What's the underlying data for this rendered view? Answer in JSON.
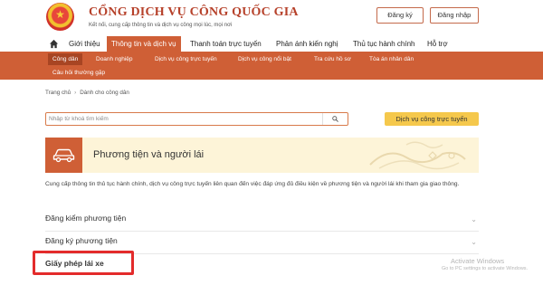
{
  "header": {
    "site_title": "CỔNG DỊCH VỤ CÔNG QUỐC GIA",
    "subtitle": "Kết nối, cung cấp thông tin và dịch vụ công mọi lúc, mọi nơi",
    "register_label": "Đăng ký",
    "login_label": "Đăng nhập"
  },
  "main_nav": {
    "items": [
      {
        "label": "Giới thiệu"
      },
      {
        "label": "Thông tin và dịch vụ"
      },
      {
        "label": "Thanh toán trực tuyến"
      },
      {
        "label": "Phản ánh kiến nghị"
      },
      {
        "label": "Thủ tục hành chính"
      },
      {
        "label": "Hỗ trợ"
      }
    ],
    "active": "Thông tin và dịch vụ"
  },
  "sub_nav": {
    "items": [
      {
        "label": "Công dân"
      },
      {
        "label": "Doanh nghiệp"
      },
      {
        "label": "Dịch vụ công trực tuyến"
      },
      {
        "label": "Dịch vụ công nổi bật"
      },
      {
        "label": "Tra cứu hồ sơ"
      },
      {
        "label": "Tòa án nhân dân"
      },
      {
        "label": "Câu hỏi thường gặp"
      }
    ],
    "active": "Công dân"
  },
  "breadcrumb": {
    "home": "Trang chủ",
    "separator": "›",
    "current": "Dành cho công dân"
  },
  "search": {
    "placeholder": "Nhập từ khoá tìm kiếm",
    "value": "",
    "online_service_label": "Dịch vụ công trực tuyến"
  },
  "topic": {
    "title": "Phương tiện và người lái",
    "description": "Cung cấp thông tin thủ tục hành chính, dịch vụ công trực tuyến liên quan đến việc đáp ứng đủ điều kiện về phương tiện và người lái khi tham gia giao thông."
  },
  "accordion": {
    "items": [
      {
        "label": "Đăng kiểm phương tiện"
      },
      {
        "label": "Đăng ký phương tiện"
      },
      {
        "label": "Giấy phép lái xe"
      }
    ]
  },
  "watermark": {
    "title": "Activate Windows",
    "subtitle": "Go to PC settings to activate Windows."
  },
  "colors": {
    "brand": "#cf5f36",
    "highlight": "#e32b2b",
    "accent_yellow": "#f5c84c",
    "banner_bg": "#fdf4d8"
  },
  "icons": {
    "home": "home-icon",
    "search": "search-icon",
    "topic": "car-icon"
  }
}
